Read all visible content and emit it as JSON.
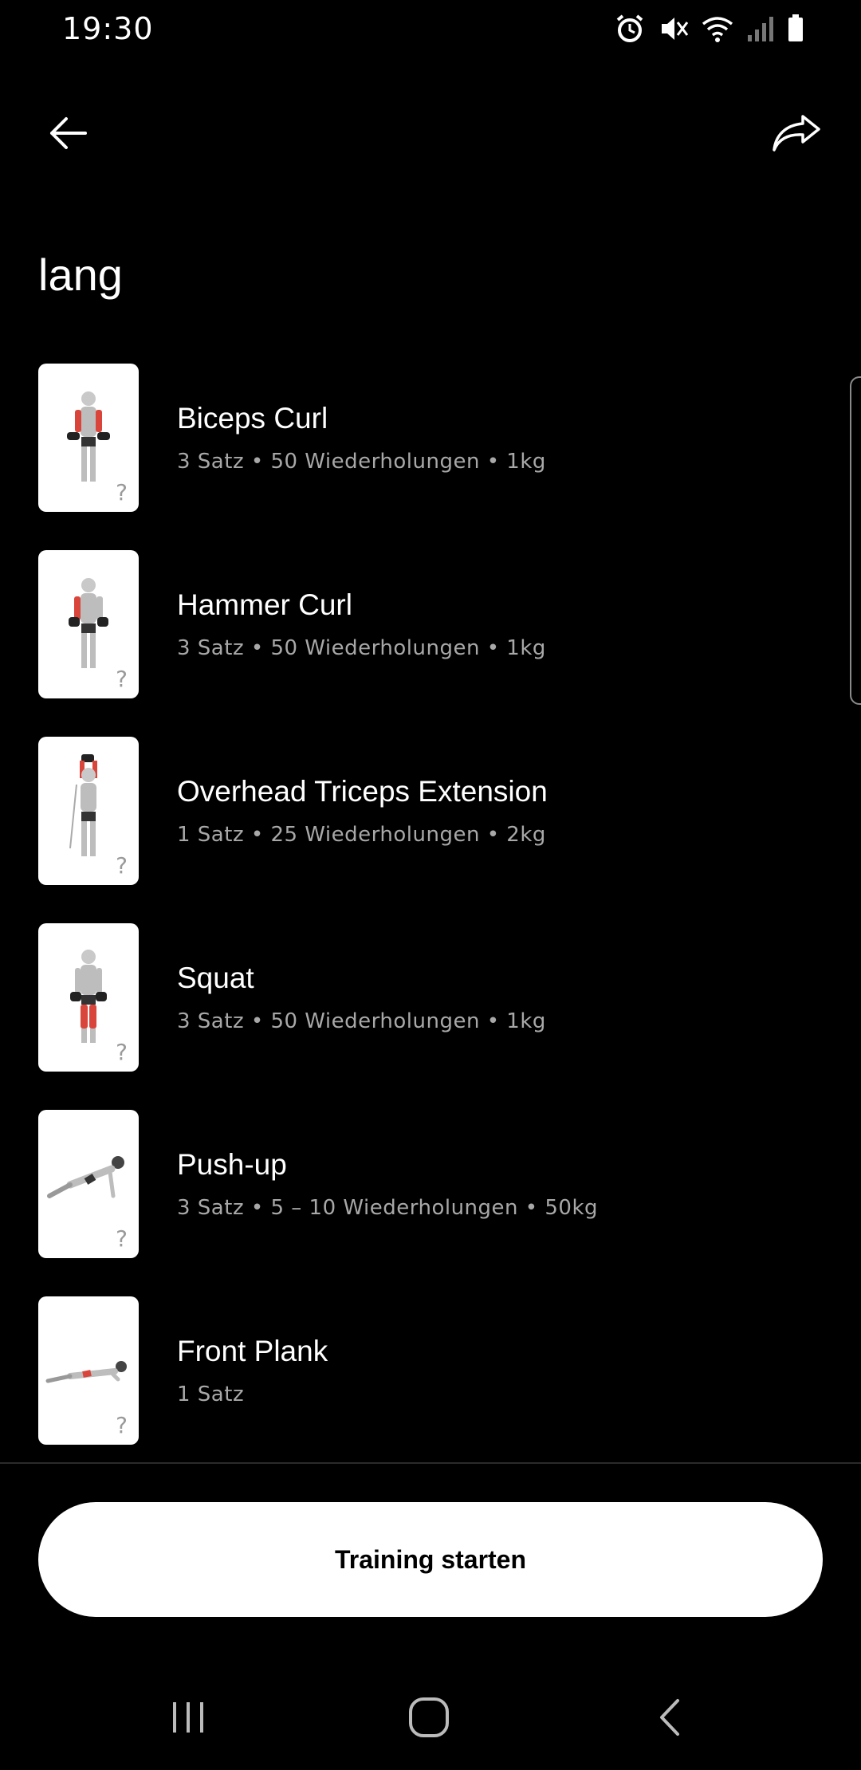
{
  "status_bar": {
    "time": "19:30",
    "icons": [
      "alarm-icon",
      "mute-icon",
      "wifi-icon",
      "signal-icon",
      "battery-icon"
    ]
  },
  "header": {
    "back_icon": "arrow-left-icon",
    "share_icon": "share-icon"
  },
  "page": {
    "title": "lang"
  },
  "exercises": [
    {
      "name": "Biceps Curl",
      "meta": "3 Satz • 50 Wiederholungen • 1kg",
      "help": "?"
    },
    {
      "name": "Hammer Curl",
      "meta": "3 Satz • 50 Wiederholungen • 1kg",
      "help": "?"
    },
    {
      "name": "Overhead Triceps Extension",
      "meta": "1 Satz • 25 Wiederholungen • 2kg",
      "help": "?"
    },
    {
      "name": "Squat",
      "meta": "3 Satz • 50 Wiederholungen • 1kg",
      "help": "?"
    },
    {
      "name": "Push-up",
      "meta": "3 Satz • 5 – 10 Wiederholungen • 50kg",
      "help": "?"
    },
    {
      "name": "Front Plank",
      "meta": "1 Satz",
      "help": "?"
    }
  ],
  "actions": {
    "start_label": "Training starten"
  },
  "nav": {
    "icons": [
      "recents-icon",
      "home-icon",
      "back-icon"
    ]
  },
  "colors": {
    "background": "#000000",
    "text": "#ffffff",
    "secondary_text": "#a8a8a8",
    "button_bg": "#ffffff",
    "highlight_muscle": "#d9453a"
  }
}
